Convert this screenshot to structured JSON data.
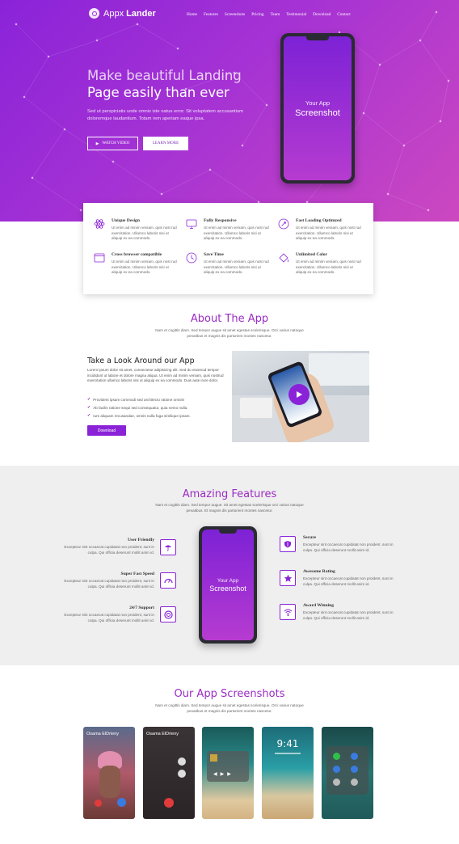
{
  "brand": {
    "name_light": "Appx",
    "name_bold": "Lander"
  },
  "nav": [
    "Home",
    "Features",
    "Screenshots",
    "Pricing",
    "Team",
    "Testimonial",
    "Download",
    "Contact"
  ],
  "hero": {
    "title_line1": "Make beautiful Landing",
    "title_line2": "Page easily than ever",
    "text": "Sed ut perspiciatis unde omnis iste natus error. Sit voluptatem accusantium doloremque laudantium. Totam rem aperiam eaque ipsa.",
    "watch_label": "WATCH VIDEO",
    "learn_label": "LEARN MORE",
    "phone_line1": "Your App",
    "phone_line2": "Screenshot"
  },
  "features": [
    {
      "title": "Unique Design",
      "text": "Ut enim ad minim veniam, quis nost rud exercitation. Ullamco laboris nisi ut aliquip ex ea commodo.",
      "icon": "atom-icon"
    },
    {
      "title": "Fully Responsive",
      "text": "Ut enim ad minim veniam, quis nost rud exercitation. Ullamco laboris nisi ut aliquip ex ea commodo.",
      "icon": "monitor-icon"
    },
    {
      "title": "Fast Loading Optimzed",
      "text": "Ut enim ad minim veniam, quis nost rud exercitation. Ullamco laboris nisi ut aliquip ex ea commodo.",
      "icon": "rocket-icon"
    },
    {
      "title": "Cross browser compatible",
      "text": "Ut enim ad minim veniam, quis nost rud exercitation. Ullamco laboris nisi ut aliquip ex ea commodo.",
      "icon": "browser-icon"
    },
    {
      "title": "Save Time",
      "text": "Ut enim ad minim veniam, quis nost rud exercitation. Ullamco laboris nisi ut aliquip ex ea commodo.",
      "icon": "clock-icon"
    },
    {
      "title": "Unlimited Color",
      "text": "Ut enim ad minim veniam, quis nost rud exercitation. Ullamco laboris nisi ut aliquip ex ea commodo.",
      "icon": "paint-bucket-icon"
    }
  ],
  "about": {
    "heading": "About The App",
    "subtext": "Nam et cogittis diam. Sed tempor augue sit amet egestas scelerisque. Orci varius natoque penatibus et magnis dis parturient montes nascetur.",
    "title": "Take a Look Around our App",
    "text": "Lorem ipsum dolor sit amet, consectetur adipisicing elit. Sed do eiusmod tempor incididunt ut labore et dolore magna aliqua. Ut enim ad minim veniam, quis nostrud exercitation ullamco laboris nisi ut aliquip ex ea commodo. Duis aute irure dolor.",
    "checks": [
      "Provident ipsam commodi sed architecto ratione omnis!",
      "Ab facilis ratione sequi sed consequatur, quia nemo nulla.",
      "Iure aliquam recusandae, omnis nulla fuga similique ipsam."
    ],
    "download_label": "Download"
  },
  "amazing": {
    "heading": "Amazing Features",
    "subtext": "Nam et cogittis diam. Sed tempor augue. Sit amet egestas scelerisque orci varius natoque penatibus. Et magnis dis parturient montes nascetur.",
    "left": [
      {
        "title": "User Friendly",
        "text": "Excepteur sint occaecat cupidatat non proident, sunt in culpa. Qui officia deserunt mollit anim id.",
        "icon": "umbrella-icon"
      },
      {
        "title": "Super Fast Speed",
        "text": "Excepteur sint occaecat cupidatat non proident, sunt in culpa. Qui officia deserunt mollit anim id.",
        "icon": "speedometer-icon"
      },
      {
        "title": "24/7 Support",
        "text": "Excepteur sint occaecat cupidatat non proident, sunt in culpa. Qui officia deserunt mollit anim id.",
        "icon": "lifebuoy-icon"
      }
    ],
    "right": [
      {
        "title": "Secure",
        "text": "Excepteur sint occaecat cupidatat non proident, sunt in culpa. Qui officia deserunt mollit anim id.",
        "icon": "shield-icon"
      },
      {
        "title": "Awesome Rating",
        "text": "Excepteur sint occaecat cupidatat non proident, sunt in culpa. Qui officia deserunt mollit anim id.",
        "icon": "star-icon"
      },
      {
        "title": "Award Winning",
        "text": "Excepteur sint occaecat cupidatat non proident, sunt in culpa. Qui officia deserunt mollit anim id.",
        "icon": "wifi-icon"
      }
    ],
    "phone_line1": "Your App",
    "phone_line2": "Screenshot"
  },
  "screenshots": {
    "heading": "Our App Screenshots",
    "subtext": "Nam et cogittis diam. Sed tempor augue sit amet egestas scelerisque. Orci varius natoque penatibus et magnis dis parturient montes nascetur.",
    "caller_name": "Osama ElDrieny",
    "lock_time": "9:41"
  },
  "colors": {
    "primary": "#8a23d8",
    "accent": "#cc48c0",
    "section_bg": "#efefef"
  }
}
